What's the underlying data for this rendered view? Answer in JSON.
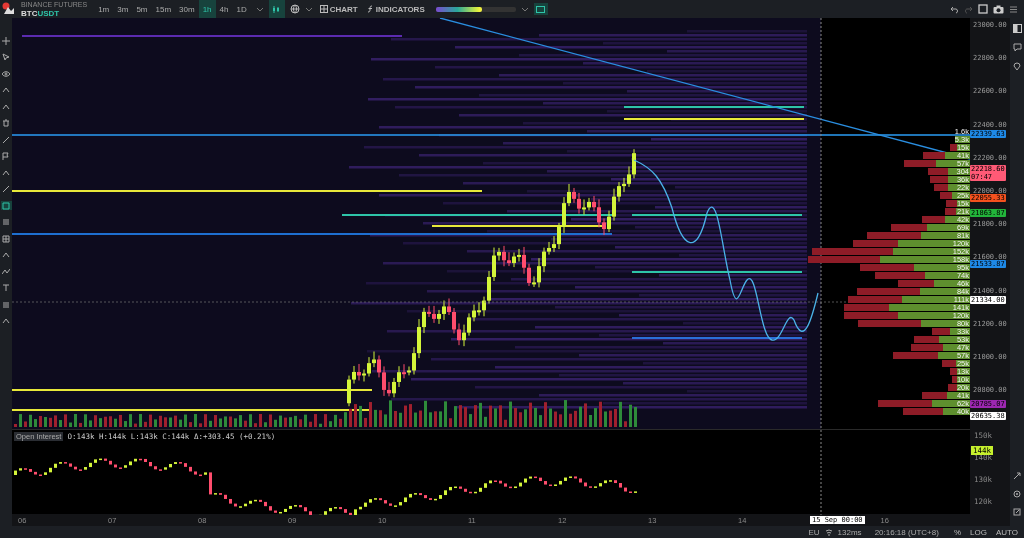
{
  "toolbar": {
    "exchange": "BINANCE FUTURES",
    "symbol_base": "BTC",
    "symbol_quote": "USDT",
    "timeframes": [
      {
        "label": "1m",
        "selected": false
      },
      {
        "label": "3m",
        "selected": false
      },
      {
        "label": "5m",
        "selected": false
      },
      {
        "label": "15m",
        "selected": false
      },
      {
        "label": "30m",
        "selected": false
      },
      {
        "label": "1h",
        "selected": true
      },
      {
        "label": "4h",
        "selected": false
      },
      {
        "label": "1D",
        "selected": false
      }
    ],
    "chart_button": "CHART",
    "indicators_button": "INDICATORS",
    "opacity_slider": {
      "level": 0.58
    }
  },
  "left_toolbar": {
    "tools": [
      {
        "selected": false
      },
      {
        "selected": false
      },
      {
        "selected": false
      },
      {
        "selected": false
      },
      {
        "selected": false
      },
      {
        "selected": false
      },
      {
        "selected": false
      },
      {
        "selected": false
      },
      {
        "selected": false
      },
      {
        "selected": false
      },
      {
        "selected": true
      },
      {
        "selected": false
      },
      {
        "selected": false
      },
      {
        "selected": false
      },
      {
        "selected": false
      },
      {
        "selected": false
      },
      {
        "selected": false
      },
      {
        "selected": false
      }
    ]
  },
  "price_axis": {
    "labels": [
      "23000.00",
      "22800.00",
      "22600.00",
      "22400.00",
      "22200.00",
      "22000.00",
      "21800.00",
      "21600.00",
      "21400.00",
      "21200.00",
      "21000.00",
      "20800.00"
    ]
  },
  "price_tags": [
    {
      "label": "22339.63",
      "color": "#1e88e5"
    },
    {
      "label": "22218.60",
      "color": "#ff5a76",
      "countdown": "07:47"
    },
    {
      "label": "22055.33",
      "color": "#f4511e"
    },
    {
      "label": "21863.87",
      "color": "#22b33a"
    },
    {
      "label": "21533.87",
      "color": "#1e88e5"
    },
    {
      "label": "21334.00",
      "color": "#ffffff"
    },
    {
      "label": "20785.07",
      "color": "#9c27b0"
    },
    {
      "label": "20635.38",
      "color": "#ffffff"
    }
  ],
  "profile": {
    "rows": [
      {
        "label": "1.6k"
      },
      {
        "label": "5.3k"
      },
      {
        "label": "15k"
      },
      {
        "label": "41k"
      },
      {
        "label": "57k"
      },
      {
        "label": "304"
      },
      {
        "label": "36k"
      },
      {
        "label": "22k"
      },
      {
        "label": "25k"
      },
      {
        "label": "15k"
      },
      {
        "label": "21k"
      },
      {
        "label": "42k"
      },
      {
        "label": "69k"
      },
      {
        "label": "81k"
      },
      {
        "label": "120k"
      },
      {
        "label": "152k"
      },
      {
        "label": "158k"
      },
      {
        "label": "95k"
      },
      {
        "label": "74k"
      },
      {
        "label": "46k"
      },
      {
        "label": "84k"
      },
      {
        "label": "111k"
      },
      {
        "label": "141k"
      },
      {
        "label": "120k"
      },
      {
        "label": "80k"
      },
      {
        "label": "33k"
      },
      {
        "label": "53k"
      },
      {
        "label": "47k"
      },
      {
        "label": "57k"
      },
      {
        "label": "25k"
      },
      {
        "label": "13k"
      },
      {
        "label": "10k"
      },
      {
        "label": "20k"
      },
      {
        "label": "41k"
      },
      {
        "label": "62k"
      },
      {
        "label": "40k"
      }
    ]
  },
  "open_interest": {
    "title": "Open Interest",
    "ohlc": "O:143k H:144k L:143k C:144k Δ:+303.45 (+0.21%)",
    "axis_labels": [
      "150k",
      "140k",
      "130k",
      "120k"
    ],
    "current_tag": "144k"
  },
  "time_axis": {
    "labels": [
      {
        "kind": "date",
        "label": "06"
      },
      {
        "kind": "date",
        "label": "07"
      },
      {
        "kind": "date",
        "label": "08"
      },
      {
        "kind": "date",
        "label": "09"
      },
      {
        "kind": "date",
        "label": "10"
      },
      {
        "kind": "date",
        "label": "11"
      },
      {
        "kind": "date",
        "label": "12"
      },
      {
        "kind": "date",
        "label": "13"
      },
      {
        "kind": "date",
        "label": "14"
      },
      {
        "kind": "crosshair",
        "label": "15  Sep  00:00"
      },
      {
        "kind": "date",
        "label": "16"
      }
    ]
  },
  "status_bar": {
    "region": "EU",
    "latency": "132ms",
    "clock": "20:16:18 (UTC+8)",
    "percent": "%",
    "log": "LOG",
    "auto": "AUTO"
  }
}
